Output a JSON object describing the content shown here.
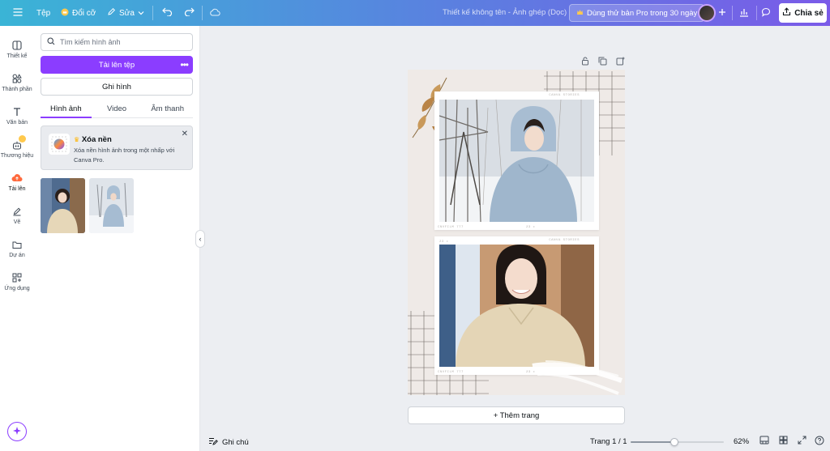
{
  "topbar": {
    "menu_icon": "hamburger-icon",
    "file_label": "Tệp",
    "resize_label": "Đổi cỡ",
    "edit_label": "Sửa",
    "title": "Thiết kế không tên - Ảnh ghép (Dọc)",
    "pro_trial_label": "Dùng thử bản Pro trong 30 ngày",
    "share_label": "Chia sẻ",
    "accent": "#8b3dff"
  },
  "rail": {
    "items": [
      {
        "label": "Thiết kế",
        "icon": "layout-icon"
      },
      {
        "label": "Thành phần",
        "icon": "elements-icon"
      },
      {
        "label": "Văn bản",
        "icon": "text-icon"
      },
      {
        "label": "Thương hiệu",
        "icon": "brand-icon"
      },
      {
        "label": "Tải lên",
        "icon": "upload-cloud-icon"
      },
      {
        "label": "Vẽ",
        "icon": "draw-icon"
      },
      {
        "label": "Dự án",
        "icon": "folder-icon"
      },
      {
        "label": "Ứng dụng",
        "icon": "apps-icon"
      }
    ]
  },
  "panel": {
    "search_placeholder": "Tìm kiếm hình ảnh",
    "upload_label": "Tải lên tệp",
    "record_label": "Ghi hình",
    "tabs": [
      "Hình ảnh",
      "Video",
      "Âm thanh"
    ],
    "promo": {
      "title": "Xóa nền",
      "description": "Xóa nền hình ảnh trong một nhấp với Canva Pro."
    }
  },
  "canvas": {
    "frame_top_label": "CANVA STORIES",
    "frame_bottom_label": "CNVFILM 777",
    "frame_number": "23 ▸",
    "frame_mini_number": "23 ▸",
    "add_page_label": "+ Thêm trang"
  },
  "bottombar": {
    "notes_label": "Ghi chú",
    "page_label": "Trang 1 / 1",
    "zoom_label": "62%",
    "zoom_fraction": 0.47
  }
}
